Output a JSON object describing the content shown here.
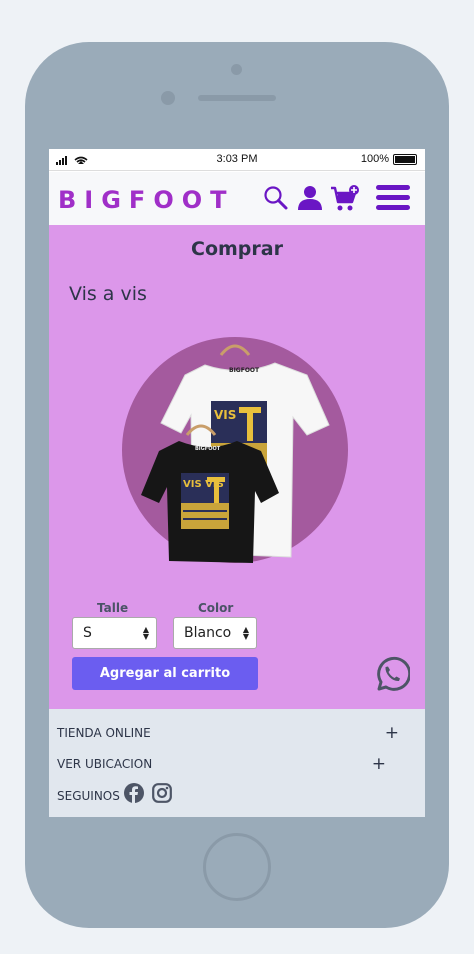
{
  "status_bar": {
    "time": "3:03 PM",
    "battery": "100%"
  },
  "header": {
    "brand": "BIGFOOT"
  },
  "main": {
    "title": "Comprar",
    "product_name": "Vis a vis",
    "size_label": "Talle",
    "size_value": "S",
    "color_label": "Color",
    "color_value": "Blanco",
    "add_to_cart": "Agregar al carrito",
    "tshirt_brand": "BIGFOOT",
    "tshirt_print": "VIS VIS"
  },
  "footer": {
    "store": "TIENDA ONLINE",
    "location": "VER UBICACION",
    "follow": "SEGUINOS",
    "expand_symbol": "+"
  },
  "colors": {
    "brand": "#a02fc8",
    "accent": "#6b5df0",
    "main_bg": "#dc97ea",
    "nav_icon": "#6a16c4"
  }
}
